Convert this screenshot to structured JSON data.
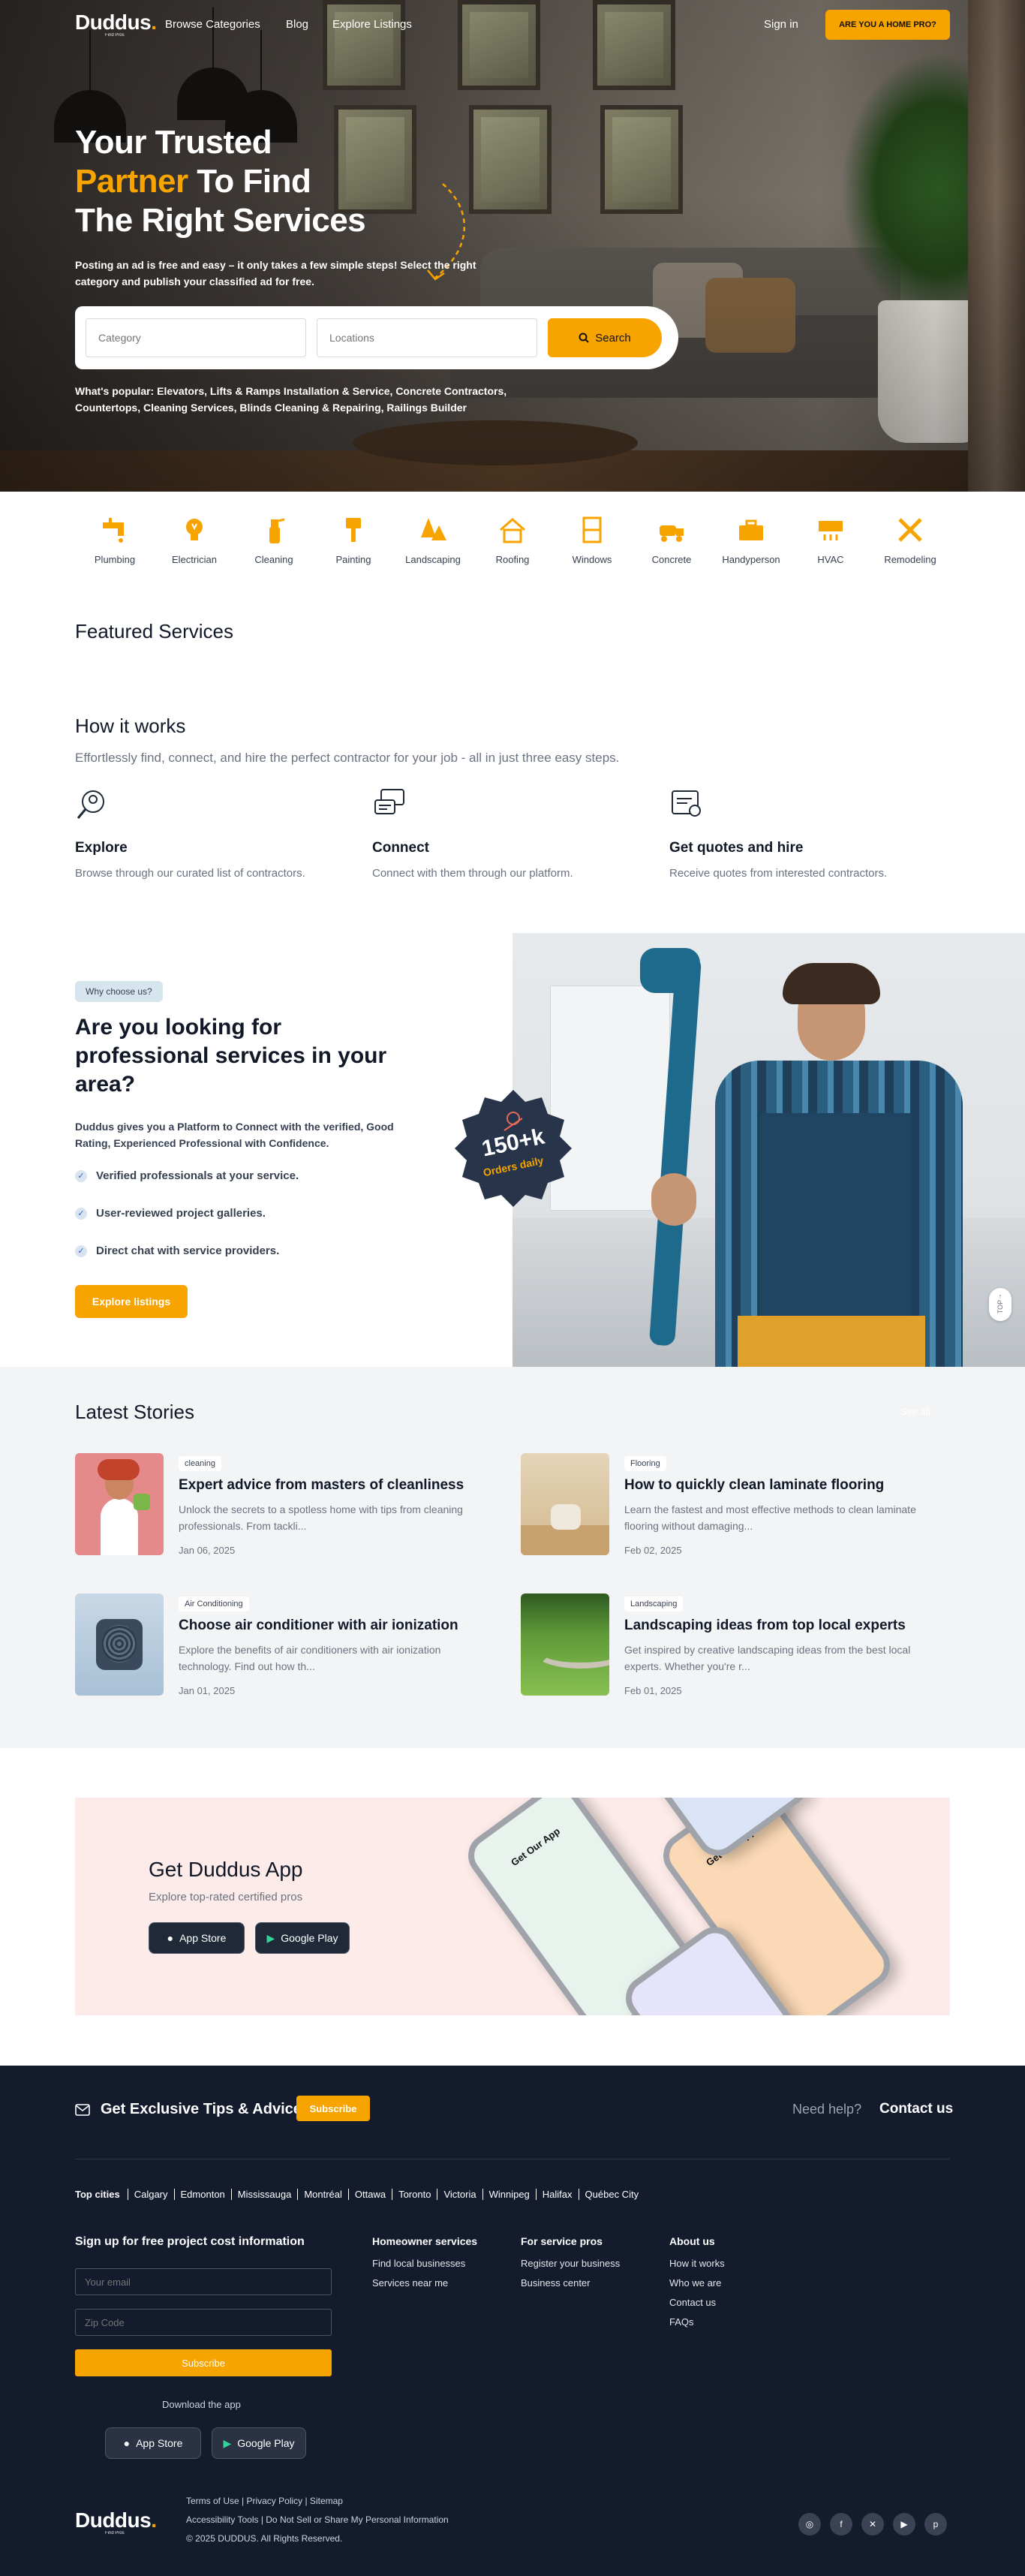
{
  "brand": {
    "name": "Duddus",
    "dot": ".",
    "tagline": "Find Pros",
    "accent": "#f7a400",
    "dark": "#141b2d"
  },
  "nav": {
    "links": [
      "Browse Categories",
      "Blog",
      "Explore Listings"
    ],
    "sign_in": "Sign in",
    "pro_button": "ARE YOU A HOME PRO?"
  },
  "hero": {
    "title_line1": "Your Trusted",
    "title_highlight": "Partner",
    "title_line2_rest": " To Find",
    "title_line3": "The Right Services",
    "subtitle": "Posting an ad is free and easy – it only takes a few simple steps! Select the right category and publish your classified ad for free.",
    "category_placeholder": "Category",
    "location_placeholder": "Locations",
    "search_label": "Search",
    "popular": "What's popular: Elevators, Lifts & Ramps Installation & Service, Concrete Contractors, Countertops, Cleaning Services, Blinds Cleaning & Repairing, Railings Builder"
  },
  "categories": [
    {
      "label": "Plumbing",
      "icon": "plumbing-icon"
    },
    {
      "label": "Electrician",
      "icon": "bulb-icon"
    },
    {
      "label": "Cleaning",
      "icon": "spray-icon"
    },
    {
      "label": "Painting",
      "icon": "paint-brush-icon"
    },
    {
      "label": "Landscaping",
      "icon": "tree-icon"
    },
    {
      "label": "Roofing",
      "icon": "house-icon"
    },
    {
      "label": "Windows",
      "icon": "window-icon"
    },
    {
      "label": "Concrete",
      "icon": "truck-icon"
    },
    {
      "label": "Handyperson",
      "icon": "toolbox-icon"
    },
    {
      "label": "HVAC",
      "icon": "hvac-icon"
    },
    {
      "label": "Remodeling",
      "icon": "tools-icon"
    }
  ],
  "featured": {
    "title": "Featured Services"
  },
  "how": {
    "title": "How it works",
    "subtitle": "Effortlessly find, connect, and hire the perfect contractor for your job - all in just three easy steps.",
    "steps": [
      {
        "title": "Explore",
        "text": "Browse through our curated list of contractors.",
        "icon": "search-person-icon"
      },
      {
        "title": "Connect",
        "text": "Connect with them through our platform.",
        "icon": "chat-icon"
      },
      {
        "title": "Get quotes and hire",
        "text": "Receive quotes from interested contractors.",
        "icon": "quote-icon"
      }
    ]
  },
  "why": {
    "badge": "Why choose us?",
    "title": "Are you looking for professional services in your area?",
    "desc": "Duddus gives you a Platform to Connect with the verified, Good Rating, Experienced Professional with Confidence.",
    "checks": [
      "Verified professionals at your service.",
      "User-reviewed project galleries.",
      "Direct chat with service providers."
    ],
    "button": "Explore listings",
    "seal_number": "150+k",
    "seal_label": "Orders daily",
    "top_label": "TOP"
  },
  "stories": {
    "title": "Latest Stories",
    "see_all": "See all",
    "items": [
      {
        "tag": "cleaning",
        "title": "Expert advice from masters of cleanliness",
        "text": "Unlock the secrets to a spotless home with tips from cleaning professionals. From tackli...",
        "date": "Jan 06, 2025"
      },
      {
        "tag": "Flooring",
        "title": "How to quickly clean laminate flooring",
        "text": "Learn the fastest and most effective methods to clean laminate flooring without damaging...",
        "date": "Feb 02, 2025"
      },
      {
        "tag": "Air Conditioning",
        "title": "Choose air conditioner with air ionization",
        "text": "Explore the benefits of air conditioners with air ionization technology. Find out how th...",
        "date": "Jan 01, 2025"
      },
      {
        "tag": "Landscaping",
        "title": "Landscaping ideas from top local experts",
        "text": "Get inspired by creative landscaping ideas from the best local experts. Whether you're r...",
        "date": "Feb 01, 2025"
      }
    ]
  },
  "app": {
    "title": "Get Duddus App",
    "subtitle": "Explore top-rated certified pros",
    "app_store": "App Store",
    "google_play": "Google Play",
    "phone_text": "Get Our App"
  },
  "footer": {
    "tips": "Get Exclusive Tips & Advice",
    "subscribe": "Subscribe",
    "help": "Need help?",
    "contact": "Contact us",
    "top_cities_label": "Top cities",
    "cities": [
      "Calgary",
      "Edmonton",
      "Mississauga",
      "Montréal",
      "Ottawa",
      "Toronto",
      "Victoria",
      "Winnipeg",
      "Halifax",
      "Québec City"
    ],
    "form_title": "Sign up for free project cost information",
    "email_placeholder": "Your email",
    "zip_placeholder": "Zip Code",
    "subscribe_button": "Subscribe",
    "download": "Download the app",
    "columns": [
      {
        "title": "Homeowner services",
        "links": [
          "Find local businesses",
          "Services near me"
        ]
      },
      {
        "title": "For service pros",
        "links": [
          "Register your business",
          "Business center"
        ]
      },
      {
        "title": "About us",
        "links": [
          "How it works",
          "Who we are",
          "Contact us",
          "FAQs"
        ]
      }
    ],
    "legal_line1": "Terms of Use | Privacy Policy | Sitemap",
    "legal_line2": "Accessibility Tools | Do Not Sell or Share My Personal Information",
    "copyright": "© 2025 DUDDUS. All Rights Reserved.",
    "social": [
      "instagram-icon",
      "facebook-icon",
      "x-icon",
      "youtube-icon",
      "pinterest-icon"
    ]
  }
}
